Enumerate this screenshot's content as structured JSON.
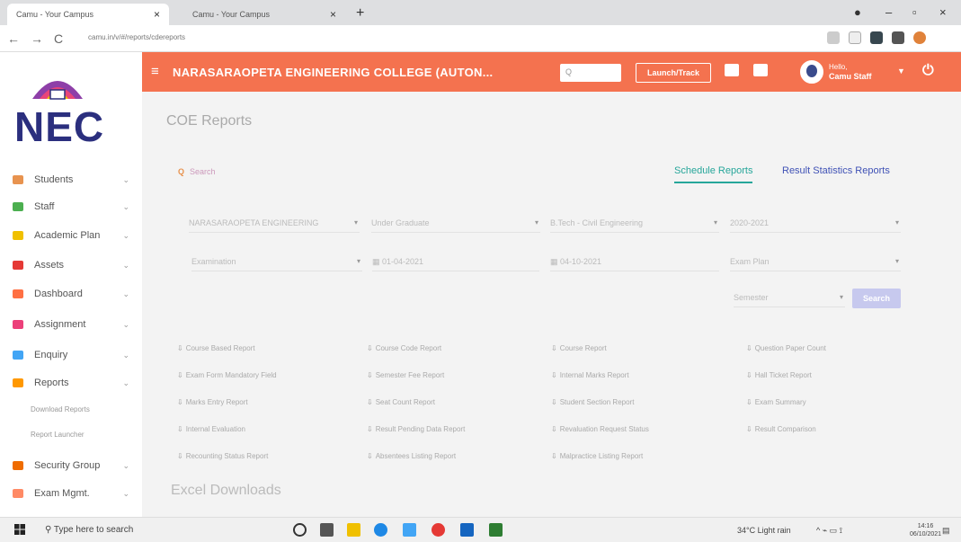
{
  "browser": {
    "tabs": [
      {
        "title": "Camu - Your Campus",
        "close": "×"
      },
      {
        "title": "Camu - Your Campus",
        "close": "×"
      }
    ],
    "new_tab": "+",
    "url": "camu.in/v/#/reports/cdereports"
  },
  "sidebar": {
    "logo": "NEC",
    "items": [
      {
        "label": "Students",
        "color": "#e8934f"
      },
      {
        "label": "Staff",
        "color": "#4caf50"
      },
      {
        "label": "Academic Plan",
        "color": "#f0c000"
      },
      {
        "label": "Assets",
        "color": "#e53935"
      },
      {
        "label": "Dashboard",
        "color": "#ff7043"
      },
      {
        "label": "Assignment",
        "color": "#ec407a"
      },
      {
        "label": "Enquiry",
        "color": "#42a5f5"
      },
      {
        "label": "Reports",
        "color": "#ff9800"
      },
      {
        "label": "Security Group",
        "color": "#ef6c00"
      },
      {
        "label": "Exam Mgmt.",
        "color": "#ff8a65"
      }
    ],
    "chevron": "⌄",
    "sub_items": [
      "Download Reports",
      "Report Launcher"
    ]
  },
  "header": {
    "menu_icon": "≡",
    "college": "NARASARAOPETA ENGINEERING COLLEGE (AUTON...",
    "search_placeholder": "Q",
    "launch": "Launch/Track",
    "user_role": "Hello,",
    "user_name": "Camu Staff",
    "power": "⏻",
    "accent": "#f4724f"
  },
  "main": {
    "title": "COE Reports",
    "search": "Search",
    "tabs": [
      "Schedule Reports",
      "Result Statistics Reports"
    ],
    "filters_row1": [
      "NARASARAOPETA ENGINEERING",
      "Under Graduate",
      "B.Tech - Civil Engineering",
      "2020-2021"
    ],
    "filters_row2": [
      "Examination",
      "01-04-2021",
      "04-10-2021",
      "Exam Plan"
    ],
    "filters_row3": [
      "Semester"
    ],
    "go": "Search",
    "report_links": [
      [
        "Course Based Report",
        "Course Code Report",
        "Course Report",
        "Question Paper Count"
      ],
      [
        "Exam Form Mandatory Field",
        "Semester Fee Report",
        "Internal Marks Report",
        "Hall Ticket Report"
      ],
      [
        "Marks Entry Report",
        "Seat Count Report",
        "Student Section Report",
        "Exam Summary"
      ],
      [
        "Internal Evaluation",
        "Result Pending Data Report",
        "Revaluation Request Status",
        "Result Comparison"
      ],
      [
        "Recounting Status Report",
        "Absentees Listing Report",
        "Malpractice Listing Report"
      ]
    ],
    "excel": "Excel Downloads"
  },
  "taskbar": {
    "search": "Type here to search",
    "weather": "34°C Light rain",
    "time": "14:16",
    "date": "06/10/2021"
  }
}
